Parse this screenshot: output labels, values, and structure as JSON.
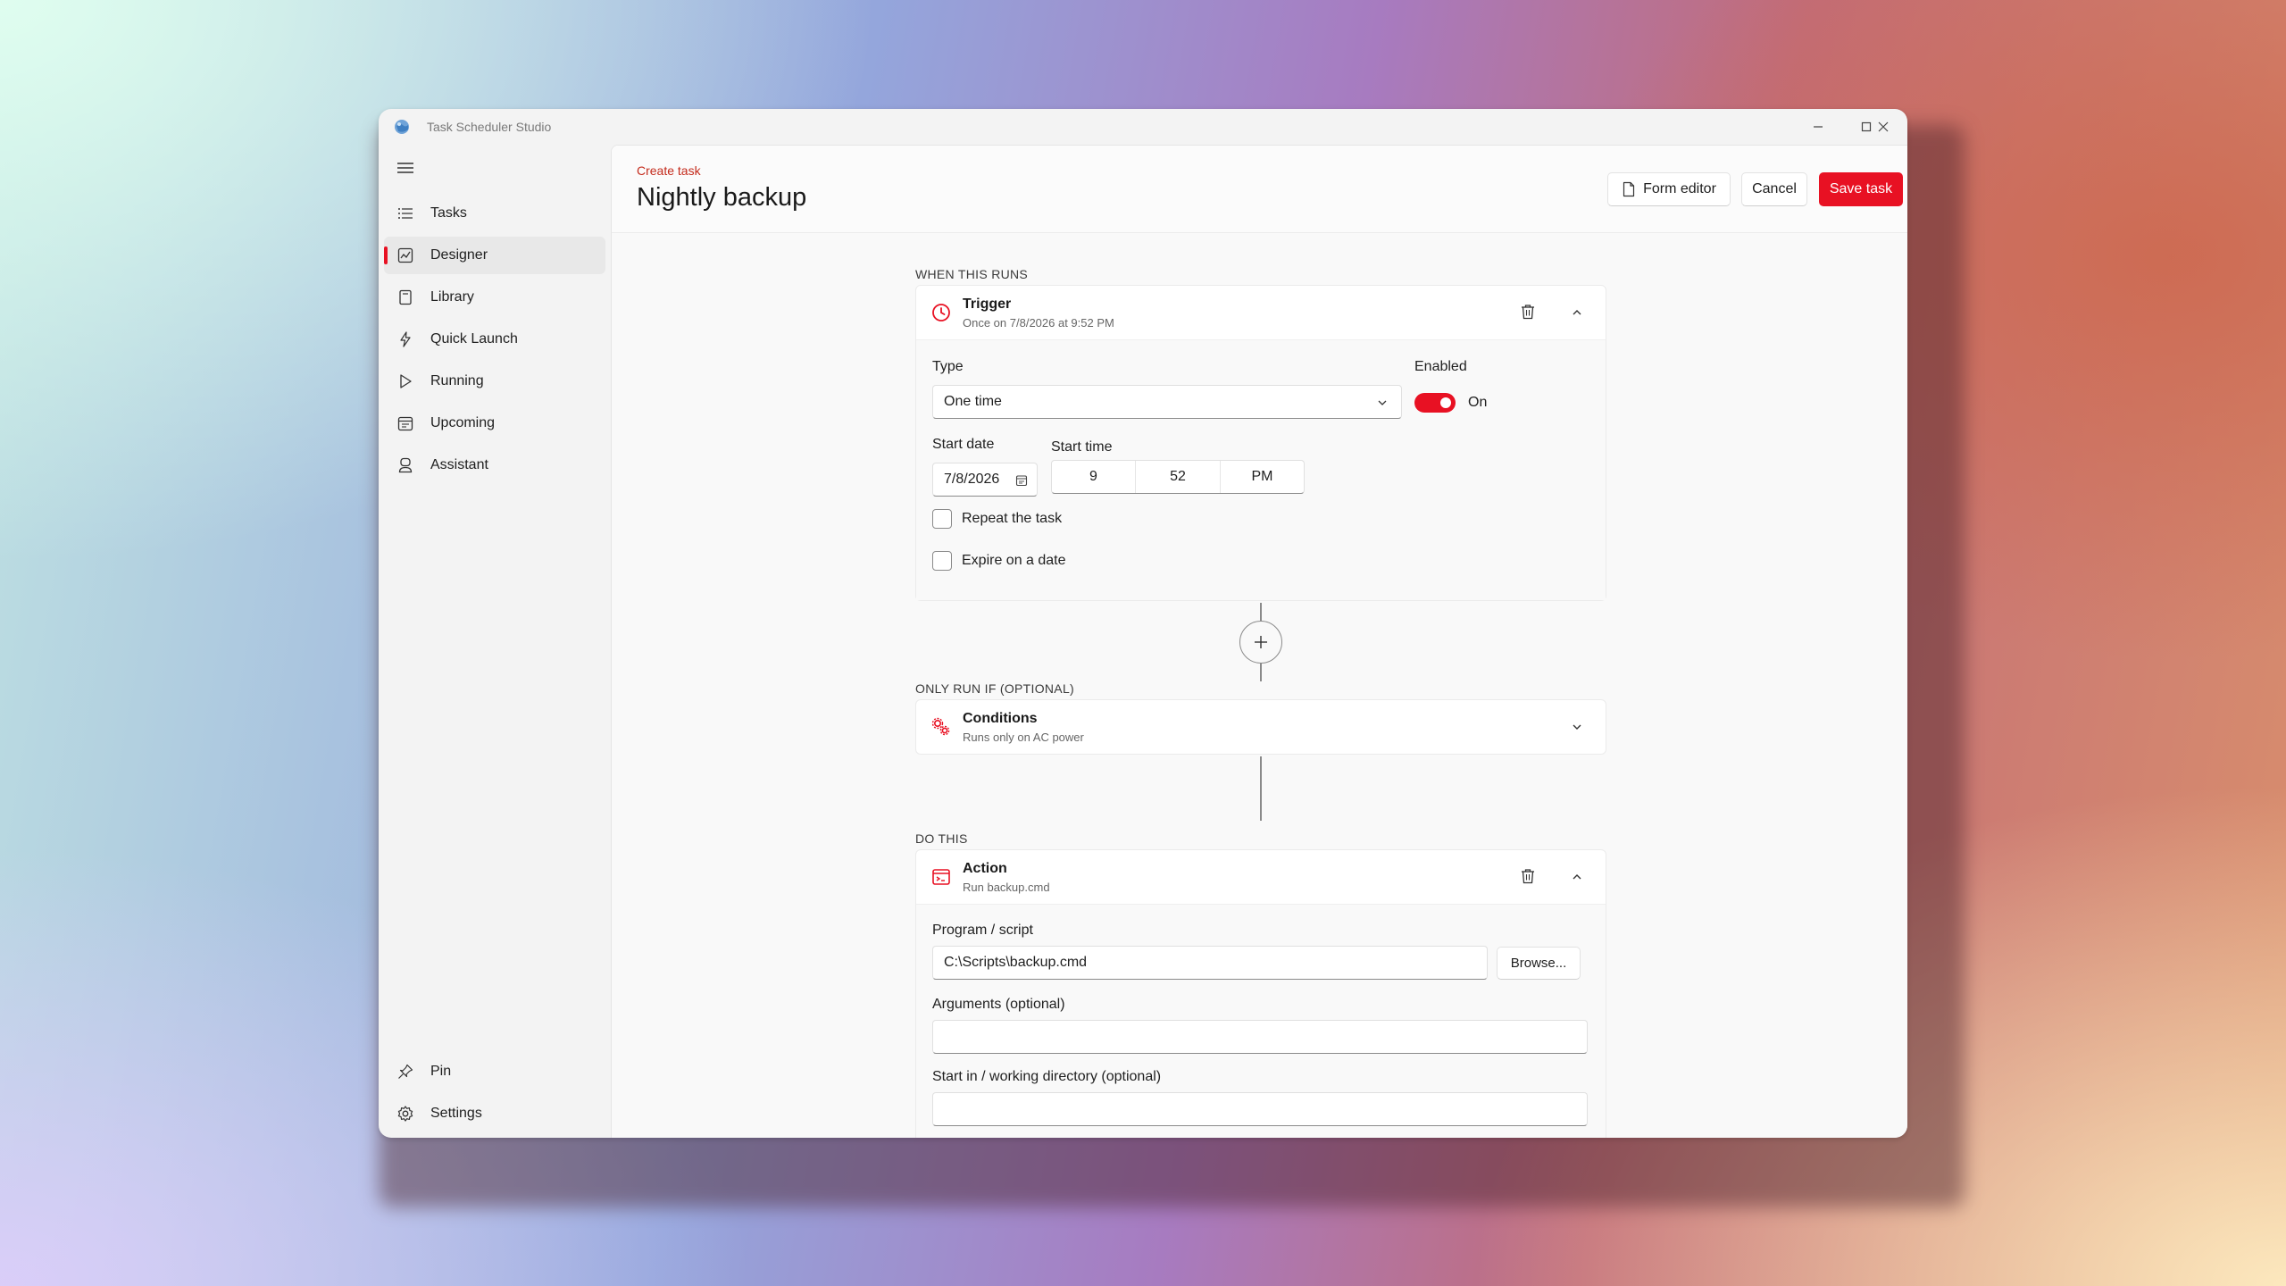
{
  "window": {
    "title": "Task Scheduler Studio"
  },
  "sidebar": {
    "items": [
      {
        "label": "Tasks",
        "icon": "list-icon"
      },
      {
        "label": "Designer",
        "icon": "designer-icon",
        "active": true
      },
      {
        "label": "Library",
        "icon": "library-icon"
      },
      {
        "label": "Quick Launch",
        "icon": "lightning-icon"
      },
      {
        "label": "Running",
        "icon": "play-icon"
      },
      {
        "label": "Upcoming",
        "icon": "calendar-icon"
      },
      {
        "label": "Assistant",
        "icon": "assistant-icon"
      }
    ],
    "footer": [
      {
        "label": "Pin",
        "icon": "pin-icon"
      },
      {
        "label": "Settings",
        "icon": "gear-icon"
      }
    ]
  },
  "header": {
    "breadcrumb": "Create task",
    "title": "Nightly backup",
    "form_editor_label": "Form editor",
    "cancel_label": "Cancel",
    "save_label": "Save task"
  },
  "trigger_section": {
    "label": "WHEN THIS RUNS",
    "card_title": "Trigger",
    "card_subtitle": "Once on 7/8/2026 at 9:52 PM",
    "type_label": "Type",
    "type_value": "One time",
    "enabled_label": "Enabled",
    "enabled_state": "On",
    "enabled": true,
    "start_date_label": "Start date",
    "start_date_value": "7/8/2026",
    "start_time_label": "Start time",
    "start_time_hour": "9",
    "start_time_minute": "52",
    "start_time_period": "PM",
    "repeat_label": "Repeat the task",
    "repeat_checked": false,
    "expire_label": "Expire on a date",
    "expire_checked": false
  },
  "conditions_section": {
    "label": "ONLY RUN IF (OPTIONAL)",
    "card_title": "Conditions",
    "card_subtitle": "Runs only on AC power"
  },
  "action_section": {
    "label": "DO THIS",
    "card_title": "Action",
    "card_subtitle": "Run backup.cmd",
    "program_label": "Program / script",
    "program_value": "C:\\Scripts\\backup.cmd",
    "browse_label": "Browse...",
    "arguments_label": "Arguments (optional)",
    "arguments_value": "",
    "start_in_label": "Start in / working directory (optional)",
    "start_in_value": ""
  },
  "colors": {
    "accent": "#e81123",
    "breadcrumb": "#c42b1c"
  }
}
